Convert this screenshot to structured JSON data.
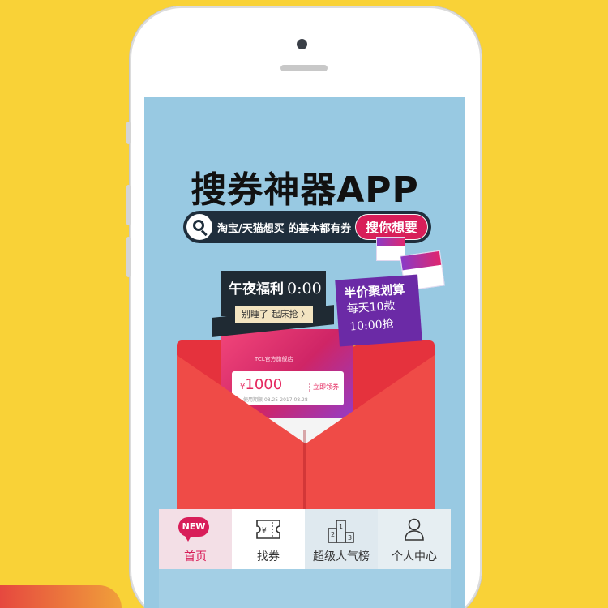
{
  "headline": "搜券神器APP",
  "search": {
    "text": "淘宝/天猫想买 的基本都有券",
    "button": "搜你想要"
  },
  "night_banner": {
    "title": "午夜福利",
    "time": "0:00",
    "tag": "别睡了 起床抢 〉"
  },
  "half_banner": {
    "line1": "半价聚划算",
    "line2": "每天10款",
    "line3": "10:00抢"
  },
  "coupon": {
    "brand": "TCL官方旗舰店",
    "currency": "¥",
    "amount": "1000",
    "date_label": "使用期限",
    "date_range": "08.25-2017.08.28",
    "action": "立即领券"
  },
  "nav": {
    "items": [
      {
        "label": "首页",
        "badge": "NEW"
      },
      {
        "label": "找券"
      },
      {
        "label": "超级人气榜"
      },
      {
        "label": "个人中心"
      }
    ]
  },
  "colors": {
    "background": "#f9d237",
    "screen": "#98c9e2",
    "accent": "#d81e59",
    "envelope": "#ef4b47",
    "purple": "#6b2aa6"
  }
}
